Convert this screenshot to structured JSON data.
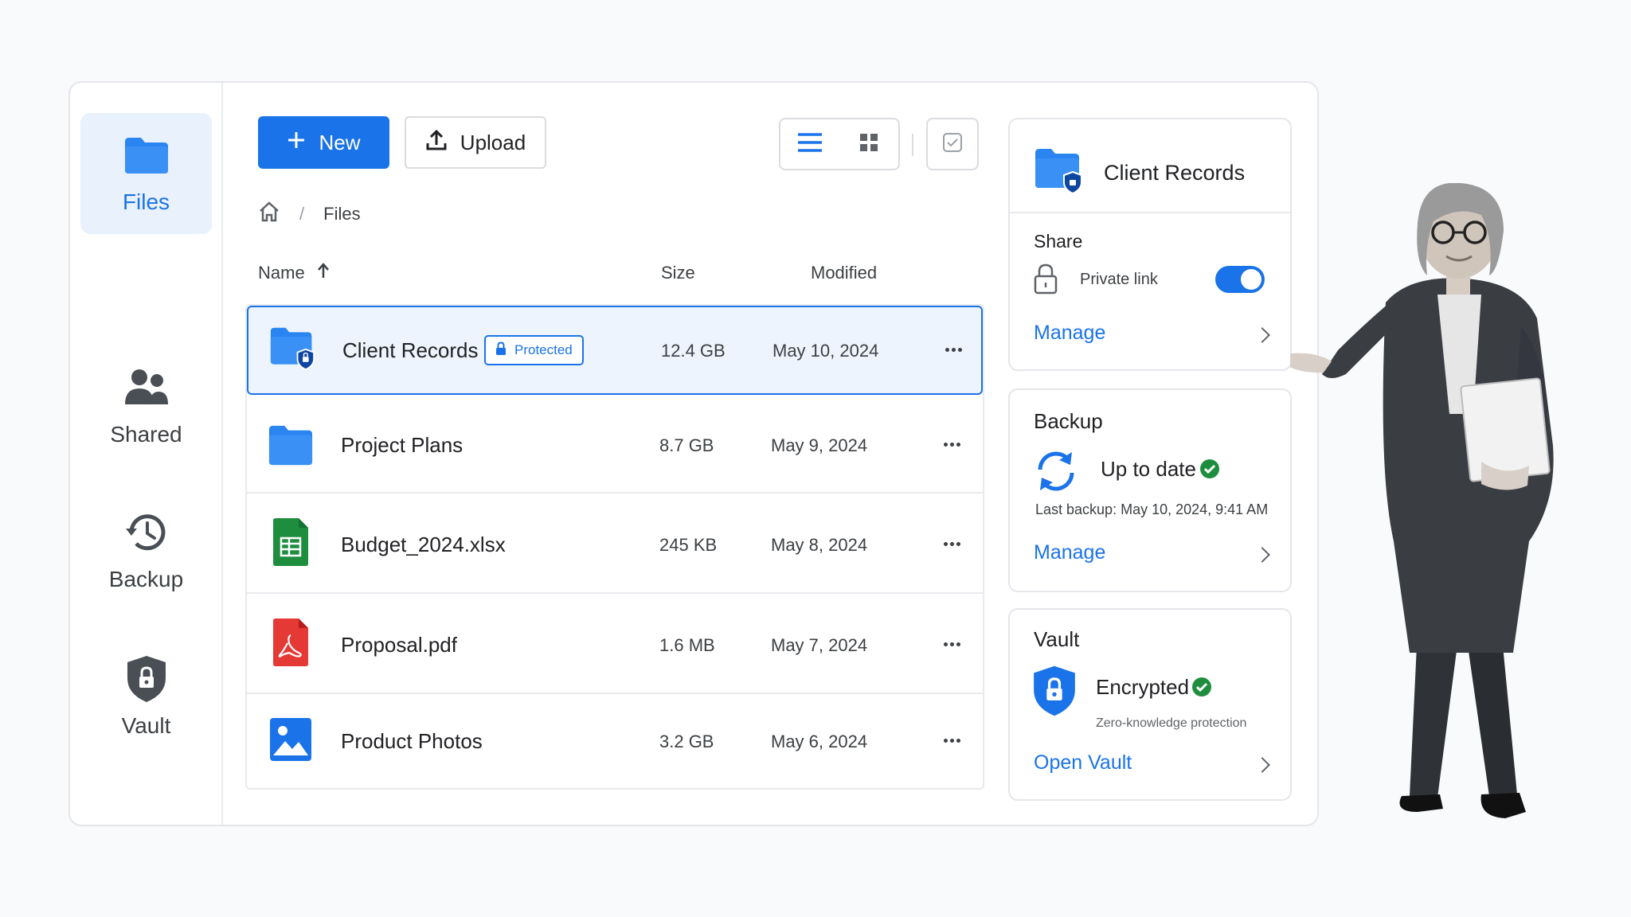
{
  "sidebar": {
    "items": [
      {
        "label": "Files",
        "icon": "folder-icon",
        "active": true
      },
      {
        "label": "Shared",
        "icon": "people-icon"
      },
      {
        "label": "Backup",
        "icon": "history-icon"
      },
      {
        "label": "Vault",
        "icon": "shield-lock-icon"
      }
    ]
  },
  "toolbar": {
    "new_label": "New",
    "upload_label": "Upload"
  },
  "breadcrumb": {
    "home_icon": "home-icon",
    "separator": "/",
    "current": "Files"
  },
  "table": {
    "headers": {
      "name": "Name",
      "size": "Size",
      "modified": "Modified"
    },
    "rows": [
      {
        "name": "Client Records",
        "size": "12.4 GB",
        "modified": "May 10, 2024",
        "icon": "protected-folder-icon",
        "badge": "Protected",
        "selected": true
      },
      {
        "name": "Project Plans",
        "size": "8.7 GB",
        "modified": "May 9, 2024",
        "icon": "folder-icon"
      },
      {
        "name": "Budget_2024.xlsx",
        "size": "245 KB",
        "modified": "May 8, 2024",
        "icon": "spreadsheet-icon"
      },
      {
        "name": "Proposal.pdf",
        "size": "1.6 MB",
        "modified": "May 7, 2024",
        "icon": "pdf-icon"
      },
      {
        "name": "Product Photos",
        "size": "3.2 GB",
        "modified": "May 6, 2024",
        "icon": "image-icon"
      }
    ]
  },
  "details": {
    "title": "Client Records",
    "share": {
      "heading": "Share",
      "private_link_label": "Private link",
      "private_link_enabled": true,
      "manage_label": "Manage"
    },
    "backup": {
      "heading": "Backup",
      "status": "Up to date",
      "last_backup": "Last backup: May 10, 2024, 9:41 AM",
      "manage_label": "Manage"
    },
    "vault": {
      "heading": "Vault",
      "status": "Encrypted",
      "subtitle": "Zero-knowledge protection",
      "open_label": "Open Vault"
    }
  },
  "colors": {
    "accent": "#1a73e8",
    "success": "#1e8e3e",
    "excel": "#1e8e3e",
    "pdf": "#e53935"
  }
}
